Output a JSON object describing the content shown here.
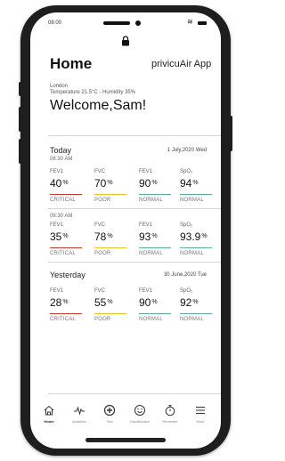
{
  "status_bar": {
    "time": "08:00"
  },
  "header": {
    "title": "Home",
    "app_name": "privicuAir App"
  },
  "location": {
    "city": "London",
    "weather": "Temperature 21.5°C - Humidity 35%"
  },
  "welcome": "Welcome,Sam!",
  "sections": [
    {
      "title": "Today",
      "date": "1 July,2020 Wed",
      "readings": [
        {
          "time": "08:30 AM",
          "metrics": [
            {
              "name": "FEV1",
              "value": "40",
              "unit": "%",
              "status": "CRITICAL",
              "color": "#c0392b"
            },
            {
              "name": "FVC",
              "value": "70",
              "unit": "%",
              "status": "POOR",
              "color": "#e6c229"
            },
            {
              "name": "FEV1",
              "value": "90",
              "unit": "%",
              "status": "NORMAL",
              "color": "#5aa9a5"
            },
            {
              "name": "SpO₂",
              "value": "94",
              "unit": "%",
              "status": "NORMAL",
              "color": "#5aa9a5"
            }
          ]
        },
        {
          "time": "08:30 AM",
          "metrics": [
            {
              "name": "FEV1",
              "value": "35",
              "unit": "%",
              "status": "CRITICAL",
              "color": "#c0392b"
            },
            {
              "name": "FVC",
              "value": "78",
              "unit": "%",
              "status": "POOR",
              "color": "#e6c229"
            },
            {
              "name": "FEV1",
              "value": "93",
              "unit": "%",
              "status": "NORMAL",
              "color": "#5aa9a5"
            },
            {
              "name": "SpO₂",
              "value": "93.9",
              "unit": "%",
              "status": "NORMAL",
              "color": "#5aa9a5"
            }
          ]
        }
      ]
    },
    {
      "title": "Yesterday",
      "date": "30 June,2020 Tue",
      "readings": [
        {
          "time": "",
          "metrics": [
            {
              "name": "FEV1",
              "value": "28",
              "unit": "%",
              "status": "CRITICAL",
              "color": "#c0392b"
            },
            {
              "name": "FVC",
              "value": "55",
              "unit": "%",
              "status": "POOR",
              "color": "#e6c229"
            },
            {
              "name": "FEV1",
              "value": "90",
              "unit": "%",
              "status": "NORMAL",
              "color": "#5aa9a5"
            },
            {
              "name": "SpO₂",
              "value": "92",
              "unit": "%",
              "status": "NORMAL",
              "color": "#5aa9a5"
            }
          ]
        }
      ]
    }
  ],
  "nav": [
    {
      "label": "Home",
      "icon": "home-icon",
      "active": true
    },
    {
      "label": "Analytics",
      "icon": "analytics-icon",
      "active": false
    },
    {
      "label": "Test",
      "icon": "plus-icon",
      "active": false
    },
    {
      "label": "Gamification",
      "icon": "smiley-icon",
      "active": false
    },
    {
      "label": "Reminder",
      "icon": "timer-icon",
      "active": false
    },
    {
      "label": "More",
      "icon": "menu-icon",
      "active": false
    }
  ]
}
